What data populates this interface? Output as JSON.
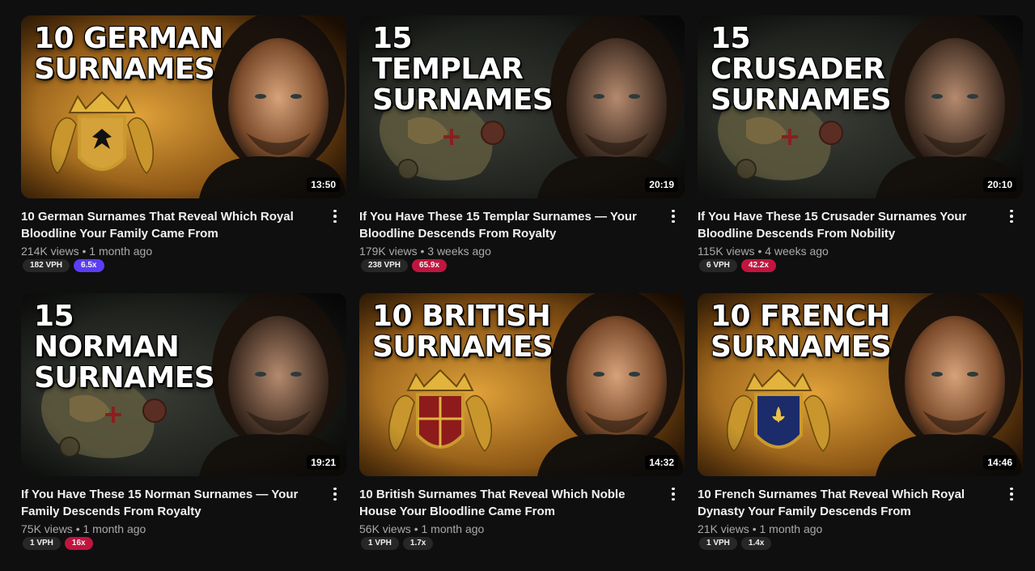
{
  "videos": [
    {
      "headline": "10 GERMAN\nSURNAMES",
      "duration": "13:50",
      "title": "10 German Surnames That Reveal Which Royal Bloodline Your Family Came From",
      "stats": "214K views • 1 month ago",
      "vph": "182 VPH",
      "multiplier": "6.5x",
      "multiplier_color": "#5b3df5",
      "theme": "gold",
      "emblem": "shield-eagle"
    },
    {
      "headline": "15 TEMPLAR\nSURNAMES",
      "duration": "20:19",
      "title": "If You Have These 15 Templar Surnames — Your Bloodline Descends From Royalty",
      "stats": "179K views • 3 weeks ago",
      "vph": "238 VPH",
      "multiplier": "65.9x",
      "multiplier_color": "#c0153f",
      "theme": "dark",
      "emblem": "map"
    },
    {
      "headline": "15 CRUSADER\nSURNAMES",
      "duration": "20:10",
      "title": "If You Have These 15 Crusader Surnames Your Bloodline Descends From Nobility",
      "stats": "115K views • 4 weeks ago",
      "vph": "6 VPH",
      "multiplier": "42.2x",
      "multiplier_color": "#c0153f",
      "theme": "dark",
      "emblem": "map"
    },
    {
      "headline": "15 NORMAN\nSURNAMES",
      "duration": "19:21",
      "title": "If You Have These 15 Norman Surnames — Your Family Descends From Royalty",
      "stats": "75K views • 1 month ago",
      "vph": "1 VPH",
      "multiplier": "16x",
      "multiplier_color": "#c0153f",
      "theme": "dark",
      "emblem": "map"
    },
    {
      "headline": "10 BRITISH\nSURNAMES",
      "duration": "14:32",
      "title": "10 British Surnames That Reveal Which Noble House Your Bloodline Came From",
      "stats": "56K views • 1 month ago",
      "vph": "1 VPH",
      "multiplier": "1.7x",
      "multiplier_color": "#272727",
      "theme": "gold",
      "emblem": "shield-lions"
    },
    {
      "headline": "10 FRENCH\nSURNAMES",
      "duration": "14:46",
      "title": "10 French Surnames That Reveal Which Royal Dynasty Your Family Descends From",
      "stats": "21K views • 1 month ago",
      "vph": "1 VPH",
      "multiplier": "1.4x",
      "multiplier_color": "#272727",
      "theme": "gold",
      "emblem": "shield-fleur"
    }
  ]
}
